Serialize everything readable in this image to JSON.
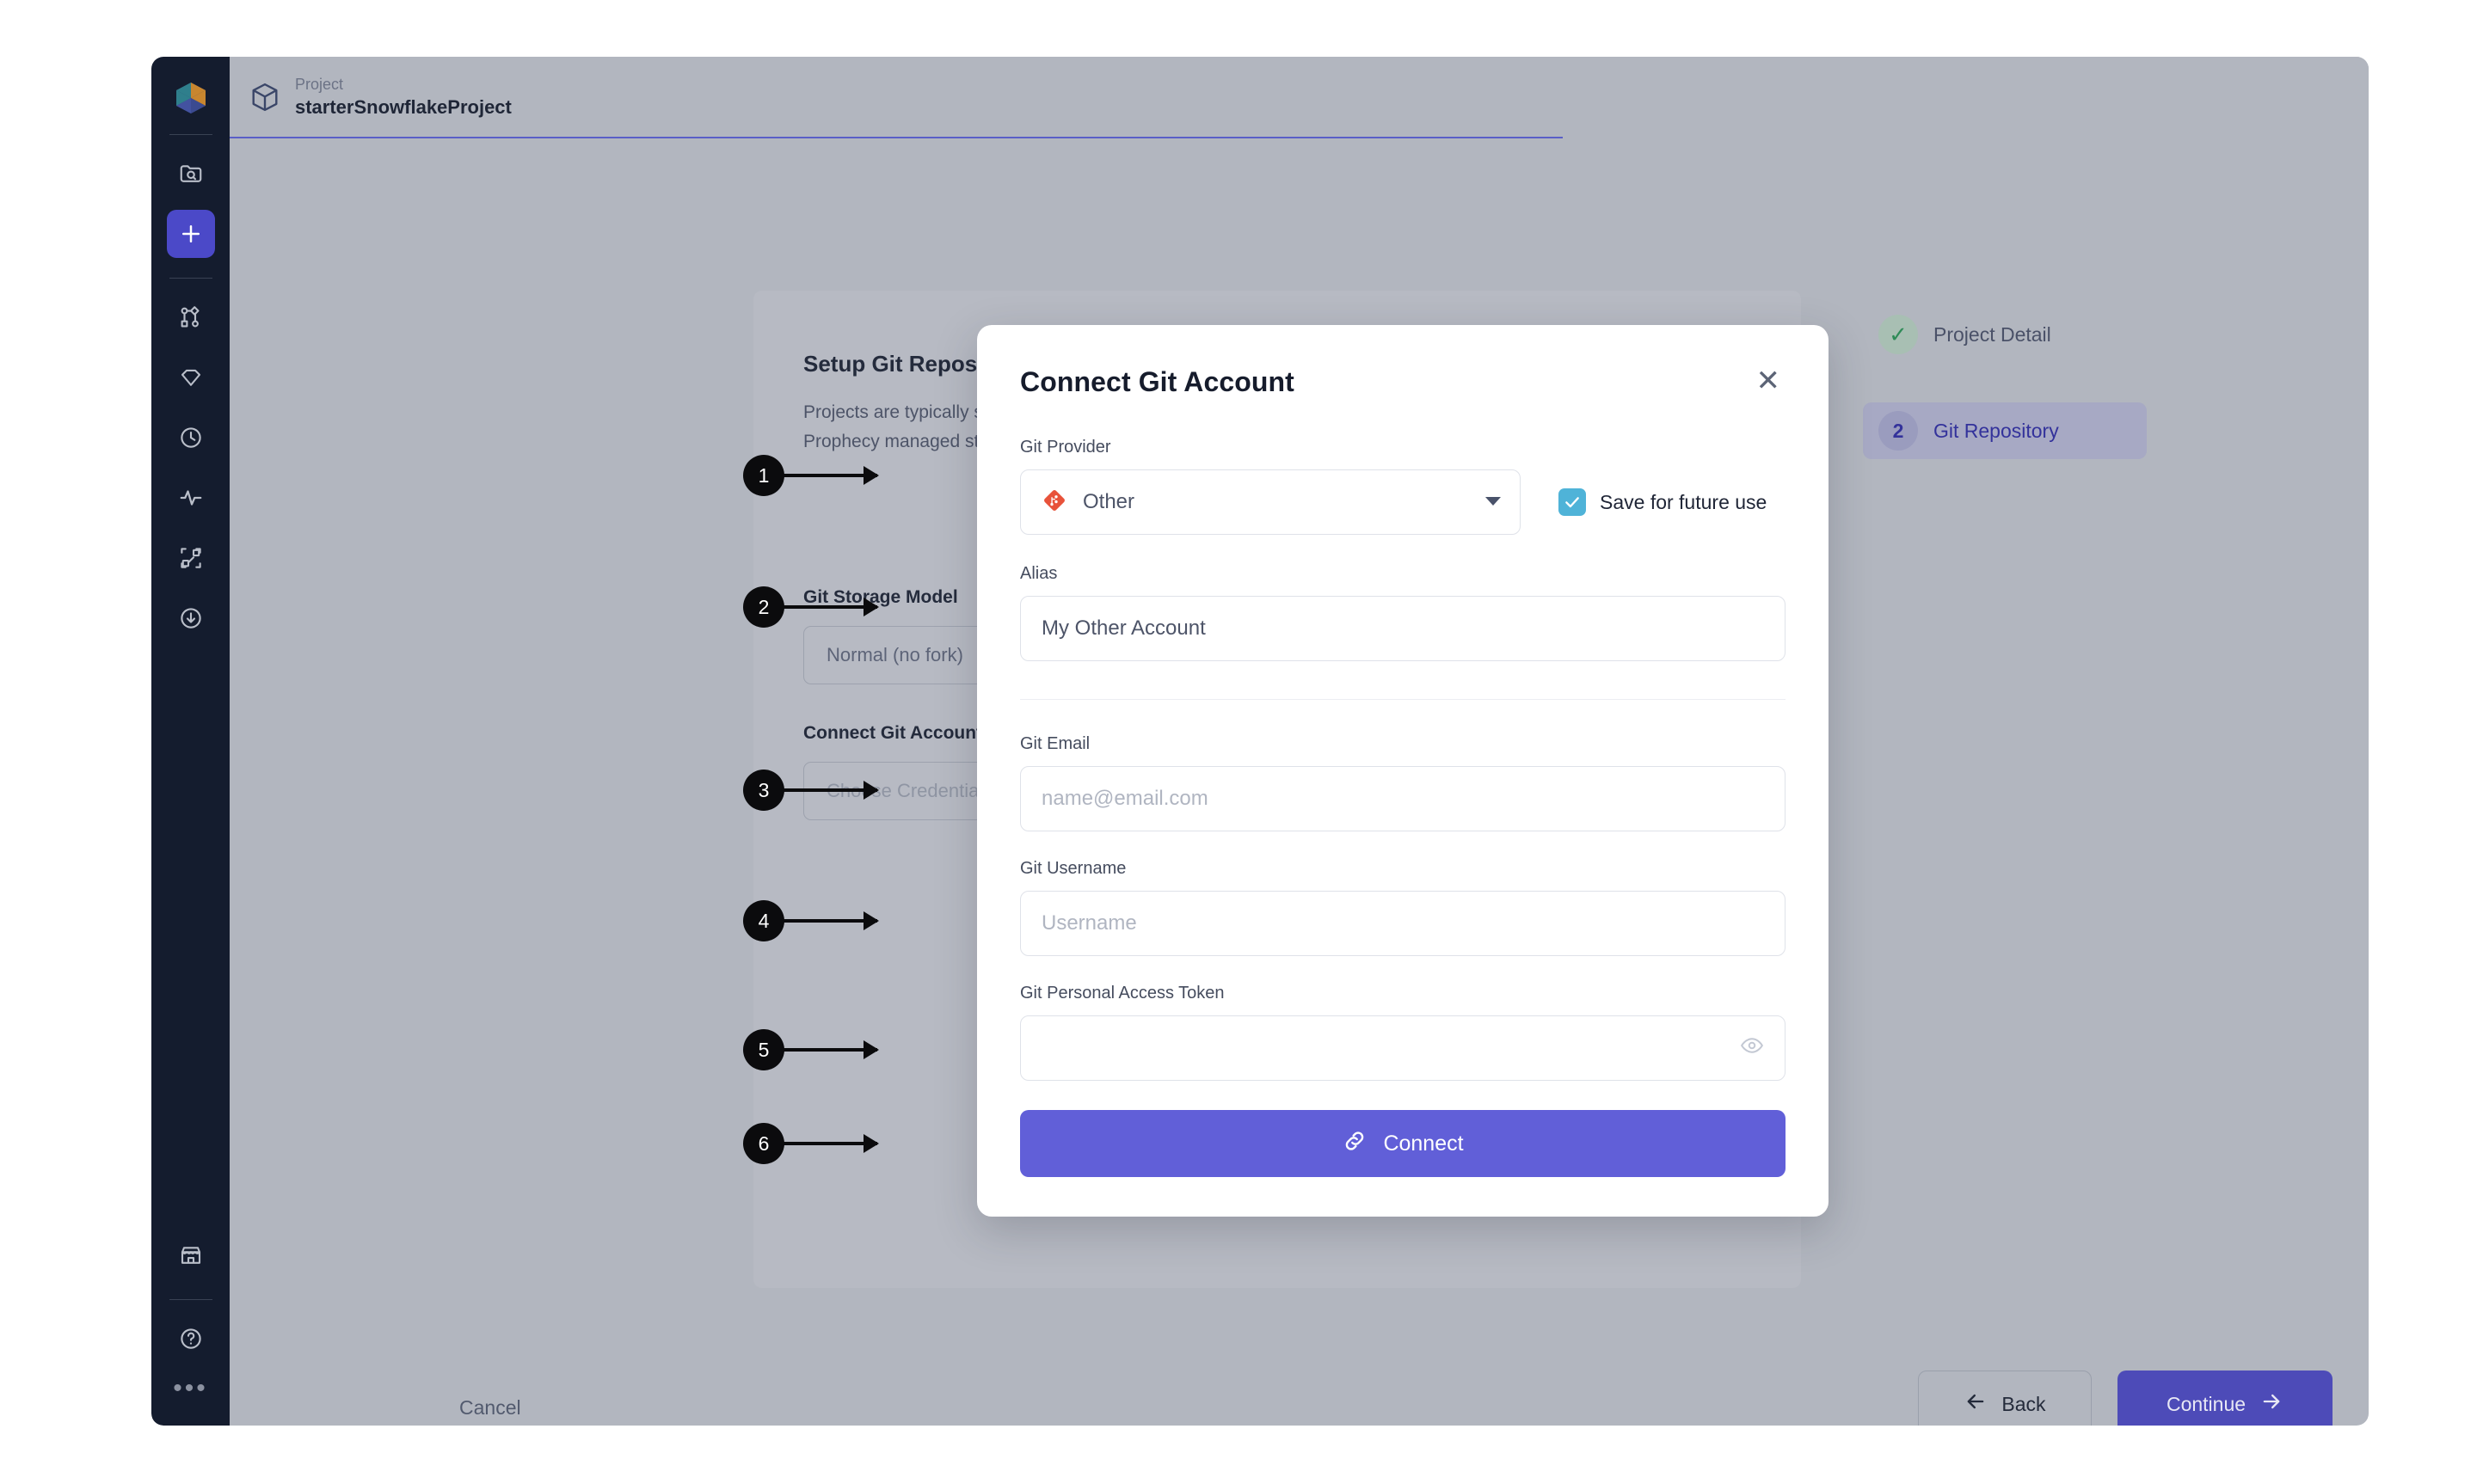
{
  "sidebar": {
    "logo_icon": "app-logo-icon",
    "items": [
      {
        "icon": "folder-search-icon",
        "active": false
      },
      {
        "icon": "plus-icon",
        "active": true
      },
      {
        "icon": "workflow-nodes-icon",
        "active": false
      },
      {
        "icon": "diamond-icon",
        "active": false
      },
      {
        "icon": "clock-icon",
        "active": false
      },
      {
        "icon": "activity-pulse-icon",
        "active": false
      },
      {
        "icon": "connected-nodes-icon",
        "active": false
      },
      {
        "icon": "download-circle-icon",
        "active": false
      }
    ],
    "bottom_items": [
      {
        "icon": "storefront-icon"
      },
      {
        "icon": "help-circle-icon"
      }
    ],
    "more_label": "•••"
  },
  "header": {
    "cube_icon": "cube-icon",
    "kicker": "Project",
    "title": "starterSnowflakeProject"
  },
  "background": {
    "title": "Setup Git Repository",
    "paragraph": "Projects are typically stored in a Git repository. You can also use Prophecy managed storage.",
    "git_storage_label": "Git Storage Model",
    "git_storage_value": "Normal (no fork)",
    "connect_account_label": "Connect Git Account",
    "credential_placeholder": "Choose Credential"
  },
  "stepper": {
    "steps": [
      {
        "badge": "✓",
        "label": "Project Detail",
        "state": "done"
      },
      {
        "badge": "2",
        "label": "Git Repository",
        "state": "current"
      }
    ]
  },
  "bottom_bar": {
    "cancel": "Cancel",
    "back": "Back",
    "back_icon": "arrow-left-icon",
    "continue": "Continue",
    "continue_icon": "arrow-right-icon"
  },
  "modal": {
    "title": "Connect Git Account",
    "close_icon": "close-icon",
    "provider": {
      "label": "Git Provider",
      "value": "Other",
      "icon": "git-logo-icon",
      "caret_icon": "chevron-down-icon"
    },
    "save_future": {
      "label": "Save for future use",
      "checked": true,
      "check_icon": "check-icon"
    },
    "alias": {
      "label": "Alias",
      "value": "My Other Account"
    },
    "git_email": {
      "label": "Git Email",
      "placeholder": "name@email.com",
      "value": ""
    },
    "git_username": {
      "label": "Git Username",
      "placeholder": "Username",
      "value": ""
    },
    "git_token": {
      "label": "Git Personal Access Token",
      "placeholder": "",
      "value": "",
      "reveal_icon": "eye-icon"
    },
    "connect_button": {
      "label": "Connect",
      "icon": "link-icon"
    }
  },
  "annotations": [
    {
      "number": "1",
      "target": "git-provider-select"
    },
    {
      "number": "2",
      "target": "alias-input"
    },
    {
      "number": "3",
      "target": "git-email-input"
    },
    {
      "number": "4",
      "target": "git-username-input"
    },
    {
      "number": "5",
      "target": "git-token-input"
    },
    {
      "number": "6",
      "target": "connect-button"
    }
  ],
  "colors": {
    "accent": "#4d4bb8",
    "modal_accent": "#615fd8",
    "checkbox": "#4fb3d8",
    "rail_bg": "#141c2e",
    "canvas": "#b2b6bf",
    "git_logo": "#e8523a",
    "done_check": "#2e8b57"
  }
}
